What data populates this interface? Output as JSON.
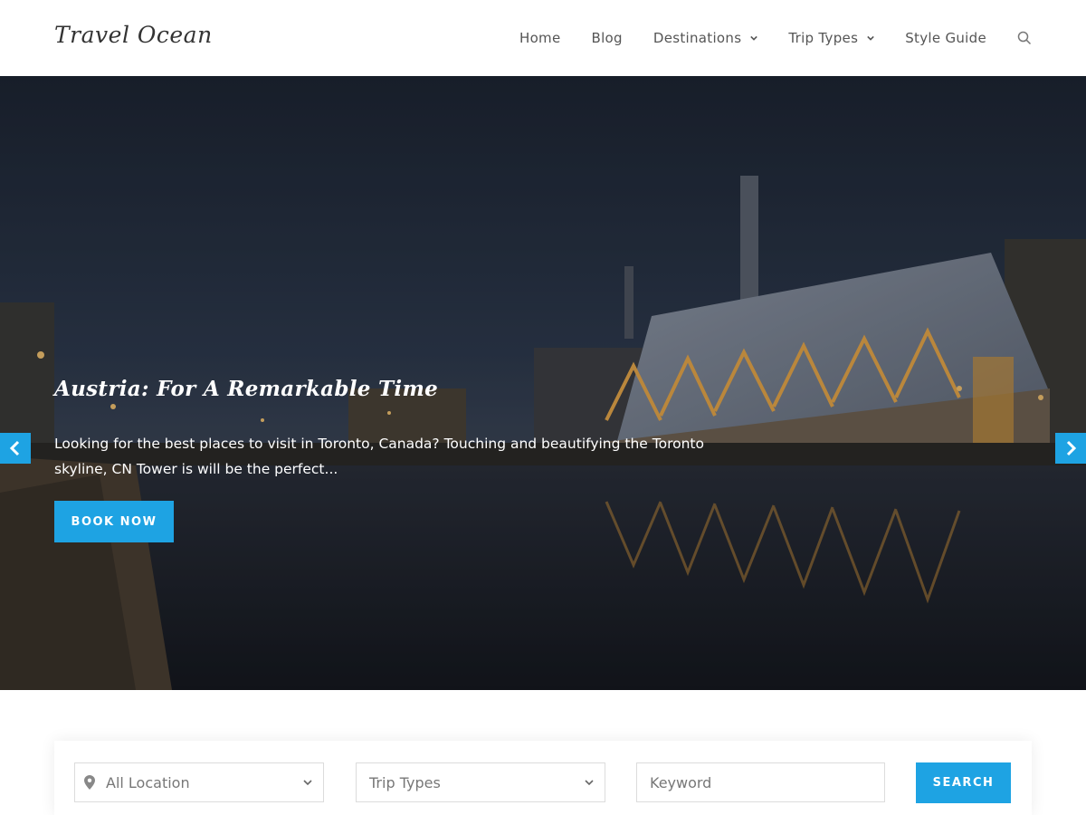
{
  "site": {
    "logo": "Travel Ocean"
  },
  "nav": {
    "items": [
      {
        "label": "Home",
        "dropdown": false
      },
      {
        "label": "Blog",
        "dropdown": false
      },
      {
        "label": "Destinations",
        "dropdown": true
      },
      {
        "label": "Trip Types",
        "dropdown": true
      },
      {
        "label": "Style Guide",
        "dropdown": false
      }
    ],
    "search_icon": "search-icon"
  },
  "hero": {
    "title": "Austria: For A Remarkable Time",
    "description": "Looking for the best places to visit in Toronto, Canada? Touching and beautifying the Toronto skyline, CN Tower is will be the perfect...",
    "cta_label": "BOOK NOW",
    "prev_icon": "chevron-left-icon",
    "next_icon": "chevron-right-icon"
  },
  "search": {
    "location_value": "All Location",
    "location_icon": "map-pin-icon",
    "trip_types_value": "Trip Types",
    "keyword_placeholder": "Keyword",
    "button_label": "SEARCH"
  },
  "colors": {
    "accent": "#1ea3e3",
    "text": "#555555"
  }
}
